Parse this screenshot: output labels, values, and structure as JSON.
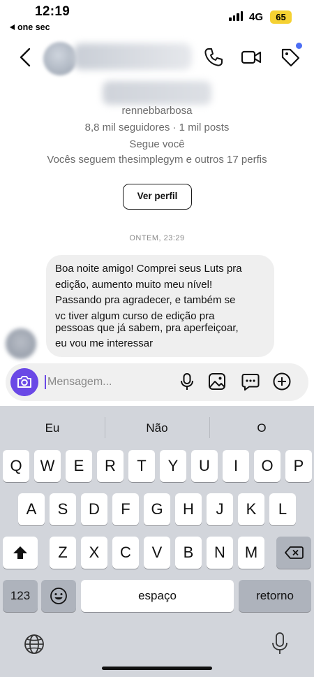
{
  "status_bar": {
    "time": "12:19",
    "back_app": "one sec",
    "network": "4G",
    "battery": "65"
  },
  "profile": {
    "username": "rennebbarbosa",
    "stats": "8,8 mil seguidores · 1 mil posts",
    "follows_you": "Segue você",
    "mutuals": "Vocês seguem thesimplegym e outros 17 perfis",
    "view_profile_label": "Ver perfil"
  },
  "chat": {
    "timestamp": "ONTEM, 23:29",
    "message_lines": [
      "Boa noite amigo! Comprei seus Luts pra",
      "edição, aumento muito meu nível!",
      "Passando pra agradecer, e também se",
      "vc tiver algum curso de edição pra",
      "pessoas que já sabem, pra aperfeiçoar,",
      "eu vou me interessar"
    ]
  },
  "composer": {
    "placeholder": "Mensagem...",
    "value": ""
  },
  "keyboard": {
    "suggestions": [
      "Eu",
      "Não",
      "O"
    ],
    "row1": [
      "Q",
      "W",
      "E",
      "R",
      "T",
      "Y",
      "U",
      "I",
      "O",
      "P"
    ],
    "row2": [
      "A",
      "S",
      "D",
      "F",
      "G",
      "H",
      "J",
      "K",
      "L"
    ],
    "row3": [
      "Z",
      "X",
      "C",
      "V",
      "B",
      "N",
      "M"
    ],
    "numbers_key": "123",
    "space_key": "espaço",
    "return_key": "retorno"
  },
  "colors": {
    "accent": "#6a48e6",
    "notification_dot": "#4c6ef5",
    "battery": "#f5d132",
    "bubble": "#efefef",
    "keyboard_bg": "#d2d5db"
  },
  "icons": [
    "back-chevron-icon",
    "phone-icon",
    "video-icon",
    "tag-icon",
    "camera-icon",
    "microphone-icon",
    "image-icon",
    "sticker-icon",
    "add-icon",
    "shift-icon",
    "backspace-icon",
    "emoji-icon",
    "globe-icon",
    "dictation-icon"
  ]
}
